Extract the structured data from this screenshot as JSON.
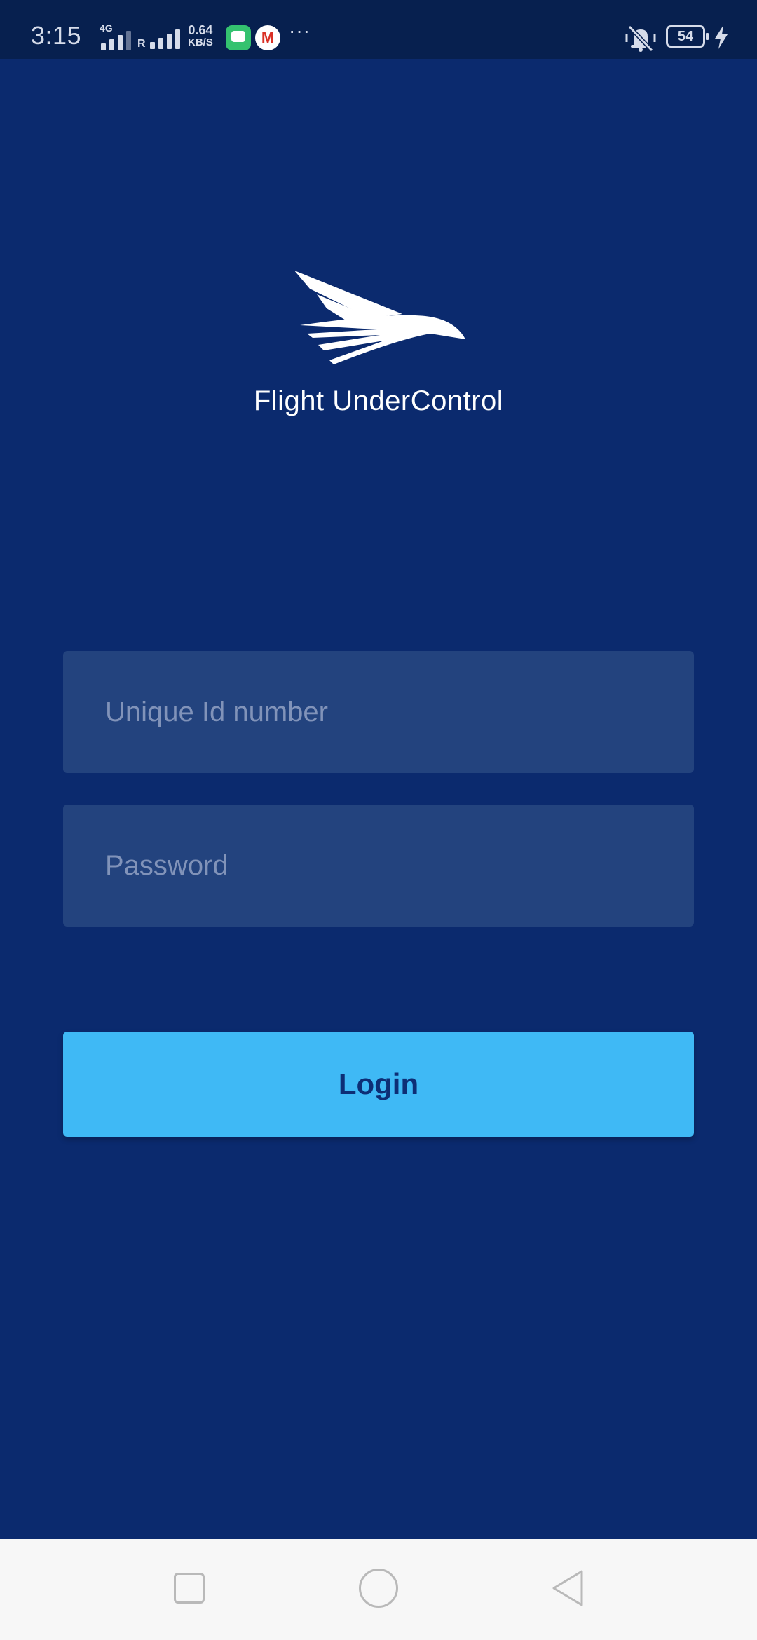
{
  "status_bar": {
    "time": "3:15",
    "network_type": "4G",
    "roaming_label": "R",
    "net_speed_value": "0.64",
    "net_speed_unit": "KB/S",
    "notification_icons": [
      "message-icon",
      "gmail-icon"
    ],
    "more_indicator": "···",
    "battery_level": "54",
    "mute_status": "vibrate-off",
    "charging": true
  },
  "app": {
    "name": "Flight UnderControl",
    "logo_icon": "eagle-wing-logo"
  },
  "form": {
    "unique_id_placeholder": "Unique Id number",
    "unique_id_value": "",
    "password_placeholder": "Password",
    "password_value": "",
    "login_label": "Login"
  },
  "nav_bar": {
    "recents_icon": "square-icon",
    "home_icon": "circle-icon",
    "back_icon": "triangle-back-icon"
  },
  "colors": {
    "background": "#0b2a6e",
    "status_bar": "#07204f",
    "input_background": "#23437e",
    "placeholder": "#8193b9",
    "login_button": "#3fb9f5",
    "login_text": "#0d2e75",
    "nav_bar": "#f7f7f7"
  }
}
